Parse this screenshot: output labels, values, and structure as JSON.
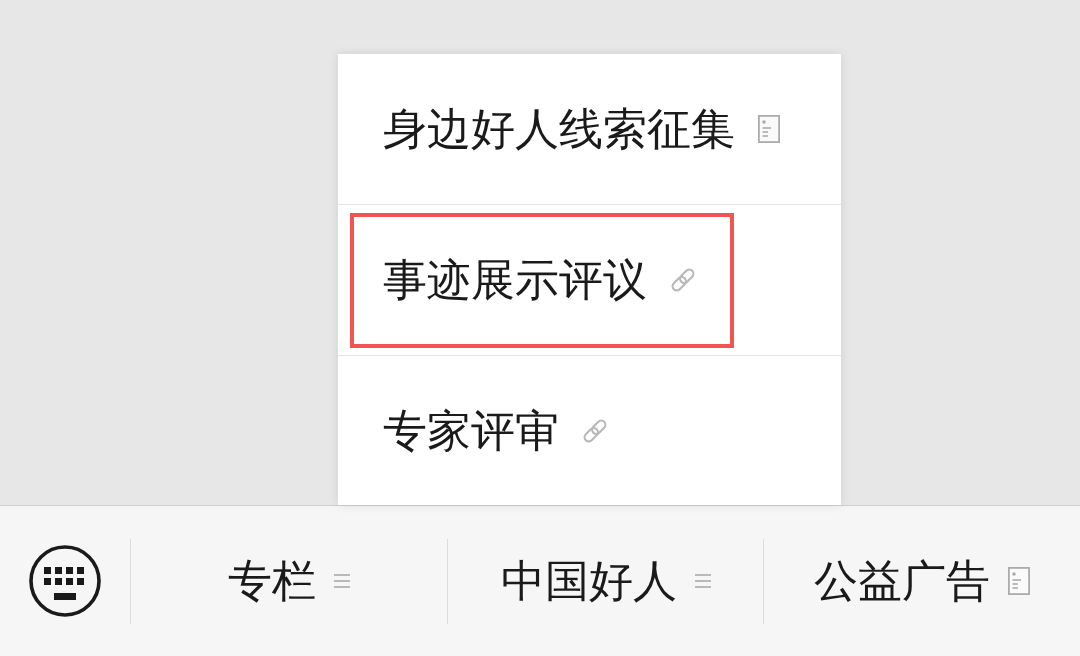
{
  "popup_menu": {
    "items": [
      {
        "label": "身边好人线索征集",
        "kind": "article",
        "highlighted": false
      },
      {
        "label": "事迹展示评议",
        "kind": "link",
        "highlighted": true
      },
      {
        "label": "专家评审",
        "kind": "link",
        "highlighted": false
      }
    ]
  },
  "bottom_bar": {
    "tabs": [
      {
        "label": "专栏",
        "kind": "submenu"
      },
      {
        "label": "中国好人",
        "kind": "submenu"
      },
      {
        "label": "公益广告",
        "kind": "article"
      }
    ]
  }
}
